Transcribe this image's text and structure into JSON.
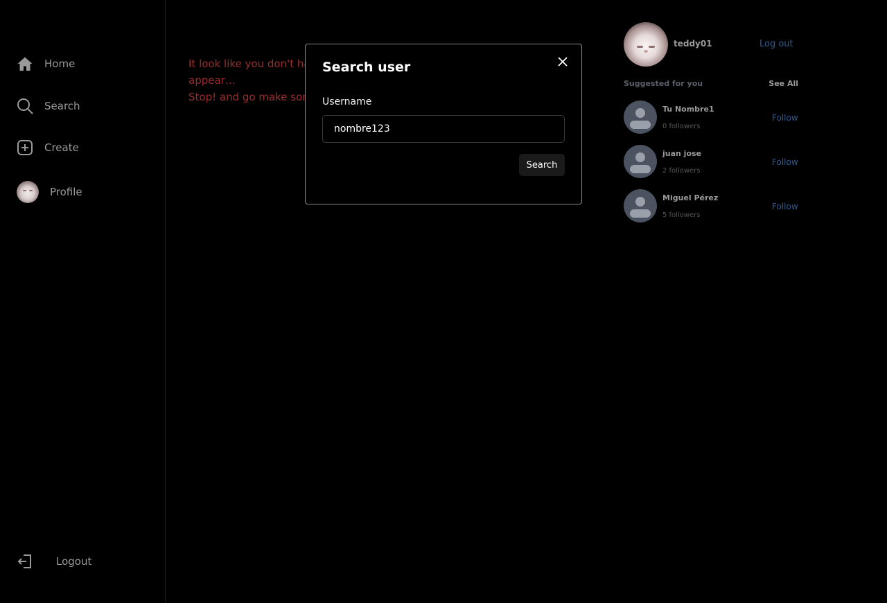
{
  "sidebar": {
    "items": [
      {
        "label": "Home",
        "icon": "home-icon"
      },
      {
        "label": "Search",
        "icon": "search-icon"
      },
      {
        "label": "Create",
        "icon": "plus-square-icon"
      },
      {
        "label": "Profile",
        "icon": "avatar"
      }
    ],
    "logout_label": "Logout"
  },
  "main": {
    "empty_line1": "It look like you don't have any followed users, maybe someday they will appear…",
    "empty_line2": "Stop! and go make some friends."
  },
  "right_panel": {
    "username": "teddy01",
    "logout_link": "Log out",
    "suggested_title": "Suggested for you",
    "see_all": "See All",
    "suggestions": [
      {
        "name": "Tu Nombre1",
        "followers": "0 followers",
        "action": "Follow"
      },
      {
        "name": "juan jose",
        "followers": "2 followers",
        "action": "Follow"
      },
      {
        "name": "Miguel Pérez",
        "followers": "5 followers",
        "action": "Follow"
      }
    ]
  },
  "modal": {
    "title": "Search user",
    "field_label": "Username",
    "field_value": "nombre123",
    "button_label": "Search"
  },
  "colors": {
    "background": "#000000",
    "error_text": "#9b2d2d",
    "link": "#2f5a92",
    "modal_border": "#8a8a8a"
  }
}
